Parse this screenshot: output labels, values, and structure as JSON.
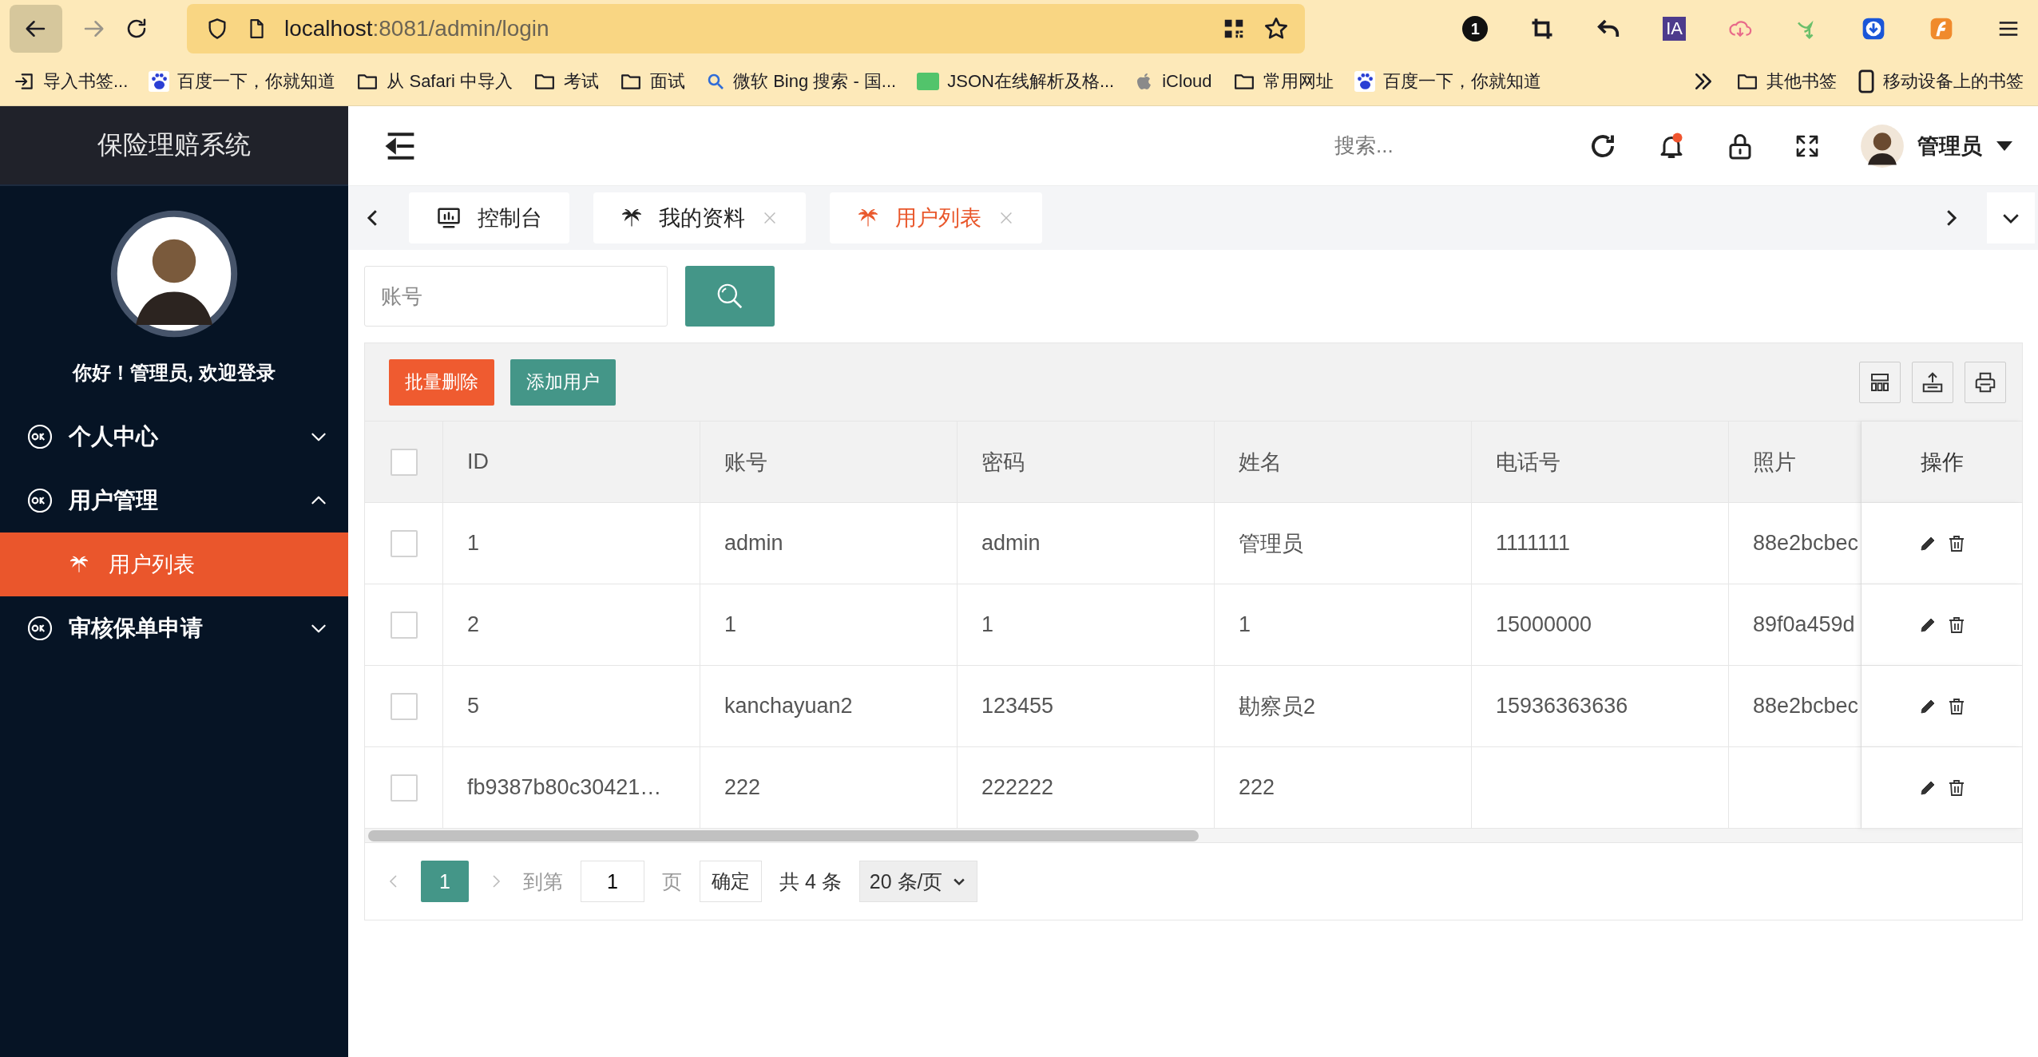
{
  "browser": {
    "url": {
      "host": "localhost",
      "path": ":8081/admin/login"
    },
    "extension_badge": "1",
    "extension_label": "IA",
    "bookmarks": [
      {
        "label": "导入书签...",
        "kind": "import"
      },
      {
        "label": "百度一下，你就知道",
        "kind": "paw"
      },
      {
        "label": "从 Safari 中导入",
        "kind": "folder"
      },
      {
        "label": "考试",
        "kind": "folder"
      },
      {
        "label": "面试",
        "kind": "folder"
      },
      {
        "label": "微软 Bing 搜索 - 国...",
        "kind": "search"
      },
      {
        "label": "JSON在线解析及格...",
        "kind": "json"
      },
      {
        "label": "iCloud",
        "kind": "apple"
      },
      {
        "label": "常用网址",
        "kind": "folder"
      },
      {
        "label": "百度一下，你就知道",
        "kind": "paw"
      }
    ],
    "bookmarks_right": [
      {
        "label": "其他书签",
        "kind": "folder"
      },
      {
        "label": "移动设备上的书签",
        "kind": "device"
      }
    ]
  },
  "sidebar": {
    "title": "保险理赔系统",
    "greeting": "你好！管理员, 欢迎登录",
    "menu": [
      {
        "label": "个人中心",
        "expanded": false
      },
      {
        "label": "用户管理",
        "expanded": true,
        "children": [
          {
            "label": "用户列表",
            "selected": true
          }
        ]
      },
      {
        "label": "审核保单申请",
        "expanded": false
      }
    ]
  },
  "header": {
    "search": {
      "placeholder": "搜索..."
    },
    "has_notification": true,
    "user": "管理员"
  },
  "tabs": [
    {
      "label": "控制台",
      "kind": "dashboard",
      "closable": false,
      "selected": false
    },
    {
      "label": "我的资料",
      "kind": "page",
      "closable": true,
      "selected": false
    },
    {
      "label": "用户列表",
      "kind": "page",
      "closable": true,
      "selected": true
    }
  ],
  "filter": {
    "placeholder": "账号"
  },
  "actions": [
    {
      "label": "批量删除",
      "kind": "danger"
    },
    {
      "label": "添加用户",
      "kind": "primary"
    }
  ],
  "table": {
    "all_checked": false,
    "columns": [
      "ID",
      "账号",
      "密码",
      "姓名",
      "电话号",
      "照片",
      "操作"
    ],
    "rows": [
      {
        "checked": false,
        "cells": [
          "1",
          "admin",
          "admin",
          "管理员",
          "1111111",
          "88e2bcbec"
        ]
      },
      {
        "checked": false,
        "cells": [
          "2",
          "1",
          "1",
          "1",
          "15000000",
          "89f0a459d"
        ]
      },
      {
        "checked": false,
        "cells": [
          "5",
          "kanchayuan2",
          "123455",
          "勘察员2",
          "15936363636",
          "88e2bcbec"
        ]
      },
      {
        "checked": false,
        "cells": [
          "fb9387b80c30421…",
          "222",
          "222222",
          "222",
          "",
          ""
        ]
      }
    ]
  },
  "pagination": {
    "pages": [
      {
        "label": "1",
        "selected": true
      }
    ],
    "goto_label": "到第",
    "goto_value": "1",
    "page_label": "页",
    "confirm": "确定",
    "total": "共 4 条",
    "page_size": "20 条/页"
  }
}
